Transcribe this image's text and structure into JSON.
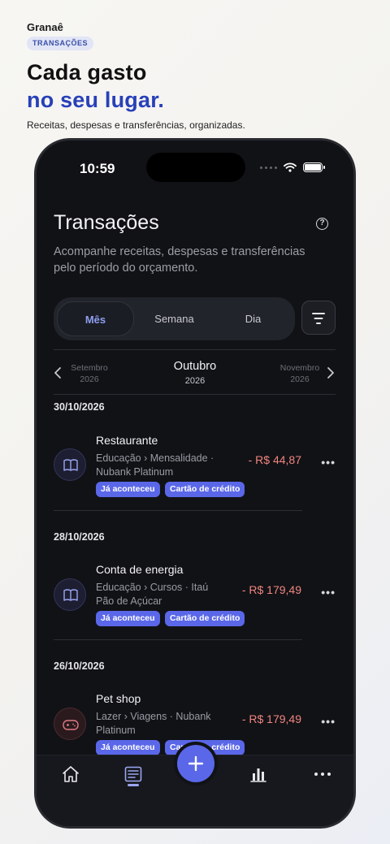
{
  "brand": "Granaê",
  "section_badge": "TRANSAÇÕES",
  "headline": {
    "line1": "Cada gasto",
    "line2": "no seu lugar."
  },
  "subtitle": "Receitas, despesas e transferências, organizadas.",
  "status_bar": {
    "time": "10:59"
  },
  "screen": {
    "title": "Transações",
    "description": "Acompanhe receitas, despesas e transferências pelo período do orçamento.",
    "segments": [
      {
        "label": "Mês",
        "active": true
      },
      {
        "label": "Semana",
        "active": false
      },
      {
        "label": "Dia",
        "active": false
      }
    ],
    "month_nav": {
      "prev": {
        "month": "Setembro",
        "year": "2026"
      },
      "current": {
        "month": "Outubro",
        "year": "2026"
      },
      "next": {
        "month": "Novembro",
        "year": "2026"
      }
    },
    "groups": [
      {
        "date": "30/10/2026",
        "tx": {
          "name": "Restaurante",
          "meta": "Educação › Mensalidade · Nubank Platinum",
          "amount": "- R$ 44,87",
          "icon": "book-icon",
          "tags": [
            "Já aconteceu",
            "Cartão de crédito"
          ]
        }
      },
      {
        "date": "28/10/2026",
        "tx": {
          "name": "Conta de energia",
          "meta": "Educação › Cursos · Itaú Pão de Açúcar",
          "amount": "- R$ 179,49",
          "icon": "book-icon",
          "tags": [
            "Já aconteceu",
            "Cartão de crédito"
          ]
        }
      },
      {
        "date": "26/10/2026",
        "tx": {
          "name": "Pet shop",
          "meta": "Lazer › Viagens · Nubank Platinum",
          "amount": "- R$ 179,49",
          "icon": "gamepad-icon",
          "tags": [
            "Já aconteceu",
            "Cartão de crédito"
          ]
        }
      }
    ],
    "tabbar": [
      "home-icon",
      "transactions-icon",
      "add-icon",
      "chart-icon",
      "more-icon"
    ]
  },
  "colors": {
    "accent": "#5a67e8",
    "expense": "#f0857f",
    "headline_blue": "#2840b8"
  }
}
